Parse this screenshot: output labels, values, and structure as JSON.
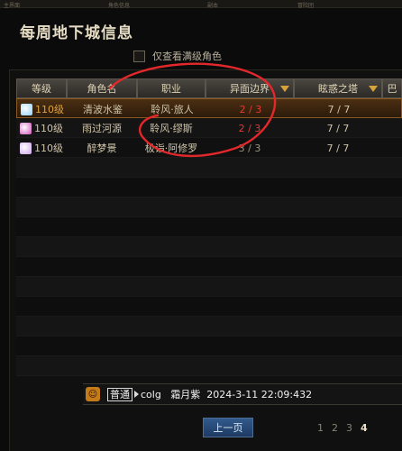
{
  "top_strip": [
    "主界面",
    "角色信息",
    "副本",
    "冒险团"
  ],
  "title": "每周地下城信息",
  "filter": {
    "label": "仅查看满级角色",
    "checked": false
  },
  "columns": [
    {
      "label": "等级",
      "sort": false
    },
    {
      "label": "角色名",
      "sort": false
    },
    {
      "label": "职业",
      "sort": false
    },
    {
      "label": "异面边界",
      "sort": true
    },
    {
      "label": "眩惑之塔",
      "sort": true
    },
    {
      "label": "巴",
      "sort": false
    }
  ],
  "rows": [
    {
      "level": "110级",
      "name": "清波水鉴",
      "class": "聆风·旅人",
      "boundary": "2 / 3",
      "tower": "7 / 7",
      "selected": true,
      "alert": true,
      "avatar_color": "#8fd0ff"
    },
    {
      "level": "110级",
      "name": "雨过河源",
      "class": "聆风·缪斯",
      "boundary": "2 / 3",
      "tower": "7 / 7",
      "selected": false,
      "alert": true,
      "avatar_color": "#d04fb8"
    },
    {
      "level": "110级",
      "name": "醉梦景",
      "class": "极诣·阿修罗",
      "boundary": "3 / 3",
      "tower": "7 / 7",
      "selected": false,
      "alert": false,
      "avatar_color": "#c9a2e8"
    }
  ],
  "chat": {
    "icon": "smiley-icon",
    "channel": "普通",
    "text": "colg   霜月紫  2024-3-11 22:09:432"
  },
  "pager": {
    "prev_label": "上一页",
    "pages": [
      "1",
      "2",
      "3",
      "4"
    ],
    "current": "4"
  },
  "annotation": {
    "color": "#e2282a",
    "shape": "circle-scribble"
  }
}
